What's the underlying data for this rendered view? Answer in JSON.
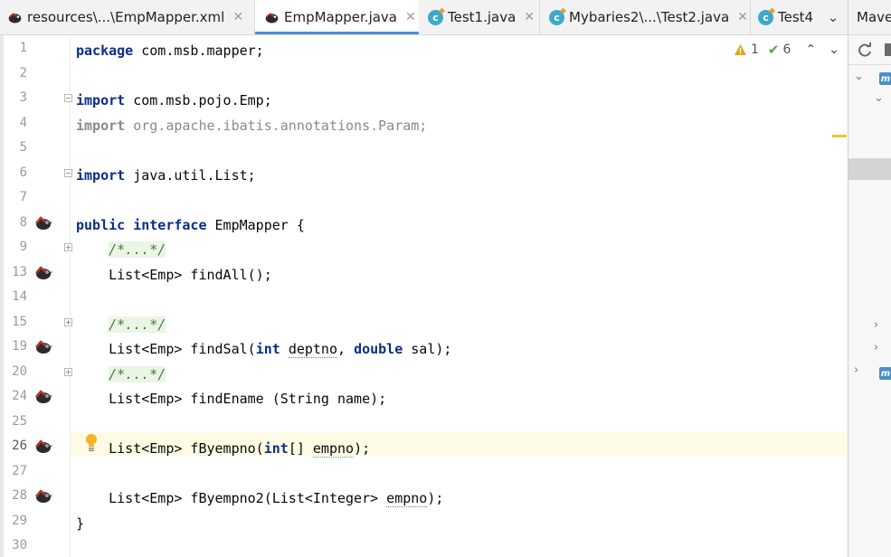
{
  "tabs": [
    {
      "label": "resources\\...\\EmpMapper.xml",
      "icon": "mybatis-bird-icon",
      "active": false
    },
    {
      "label": "EmpMapper.java",
      "icon": "mybatis-bird-icon",
      "active": true
    },
    {
      "label": "Test1.java",
      "icon": "class-icon",
      "active": false
    },
    {
      "label": "Mybaries2\\...\\Test2.java",
      "icon": "class-icon",
      "active": false
    },
    {
      "label": "Test4",
      "icon": "class-icon",
      "active": false
    }
  ],
  "tab_close_glyph": "✕",
  "tab_more_glyph": "⌄",
  "right_panel": {
    "title": "Maven"
  },
  "inspections": {
    "warnings": "1",
    "weak_warnings": "6"
  },
  "line_numbers": [
    "1",
    "2",
    "3",
    "4",
    "5",
    "6",
    "7",
    "8",
    "9",
    "13",
    "14",
    "15",
    "19",
    "20",
    "24",
    "25",
    "26",
    "27",
    "28",
    "29",
    "30"
  ],
  "current_line": "26",
  "code_lines": [
    {
      "n": "1",
      "tokens": [
        {
          "t": "package",
          "c": "kw"
        },
        {
          "t": " com.msb.mapper;"
        }
      ]
    },
    {
      "n": "2",
      "tokens": []
    },
    {
      "n": "3",
      "tokens": [
        {
          "t": "import",
          "c": "kw"
        },
        {
          "t": " com.msb.pojo.Emp;"
        }
      ]
    },
    {
      "n": "4",
      "tokens": [
        {
          "t": "import",
          "c": "gray-kw"
        },
        {
          "t": " org.apache.ibatis.annotations.Param;",
          "c": "gray"
        }
      ]
    },
    {
      "n": "5",
      "tokens": []
    },
    {
      "n": "6",
      "tokens": [
        {
          "t": "import",
          "c": "kw"
        },
        {
          "t": " java.util.List;"
        }
      ]
    },
    {
      "n": "7",
      "tokens": []
    },
    {
      "n": "8",
      "tokens": [
        {
          "t": "public",
          "c": "kw"
        },
        {
          "t": " "
        },
        {
          "t": "interface",
          "c": "kw"
        },
        {
          "t": " EmpMapper {"
        }
      ]
    },
    {
      "n": "9",
      "tokens": [
        {
          "t": "    "
        },
        {
          "t": "/*...*/",
          "c": "cmt"
        }
      ]
    },
    {
      "n": "13",
      "tokens": [
        {
          "t": "    List<Emp> findAll();"
        }
      ]
    },
    {
      "n": "14",
      "tokens": []
    },
    {
      "n": "15",
      "tokens": [
        {
          "t": "    "
        },
        {
          "t": "/*...*/",
          "c": "cmt"
        }
      ]
    },
    {
      "n": "19",
      "tokens": [
        {
          "t": "    List<Emp> findSal("
        },
        {
          "t": "int",
          "c": "kw"
        },
        {
          "t": " "
        },
        {
          "t": "deptno",
          "c": "uline"
        },
        {
          "t": ", "
        },
        {
          "t": "double",
          "c": "kw"
        },
        {
          "t": " sal);"
        }
      ]
    },
    {
      "n": "20",
      "tokens": [
        {
          "t": "    "
        },
        {
          "t": "/*...*/",
          "c": "cmt"
        }
      ]
    },
    {
      "n": "24",
      "tokens": [
        {
          "t": "    List<Emp> findEname (String name);"
        }
      ]
    },
    {
      "n": "25",
      "tokens": []
    },
    {
      "n": "26",
      "tokens": [
        {
          "t": "    List<Emp> fByempno("
        },
        {
          "t": "int",
          "c": "kw"
        },
        {
          "t": "[] "
        },
        {
          "t": "empno",
          "c": "uline"
        },
        {
          "t": ");"
        }
      ]
    },
    {
      "n": "27",
      "tokens": []
    },
    {
      "n": "28",
      "tokens": [
        {
          "t": "    List<Emp> fByempno2(List<Integer> "
        },
        {
          "t": "empno",
          "c": "uline"
        },
        {
          "t": ");"
        }
      ]
    },
    {
      "n": "29",
      "tokens": [
        {
          "t": "}"
        }
      ]
    },
    {
      "n": "30",
      "tokens": []
    }
  ],
  "colors": {
    "keyword": "#0b2d8a",
    "comment": "#3b7d3b",
    "current_line_bg": "#fdfbe3",
    "tab_accent": "#4a8fd8",
    "warning": "#e8a317"
  }
}
